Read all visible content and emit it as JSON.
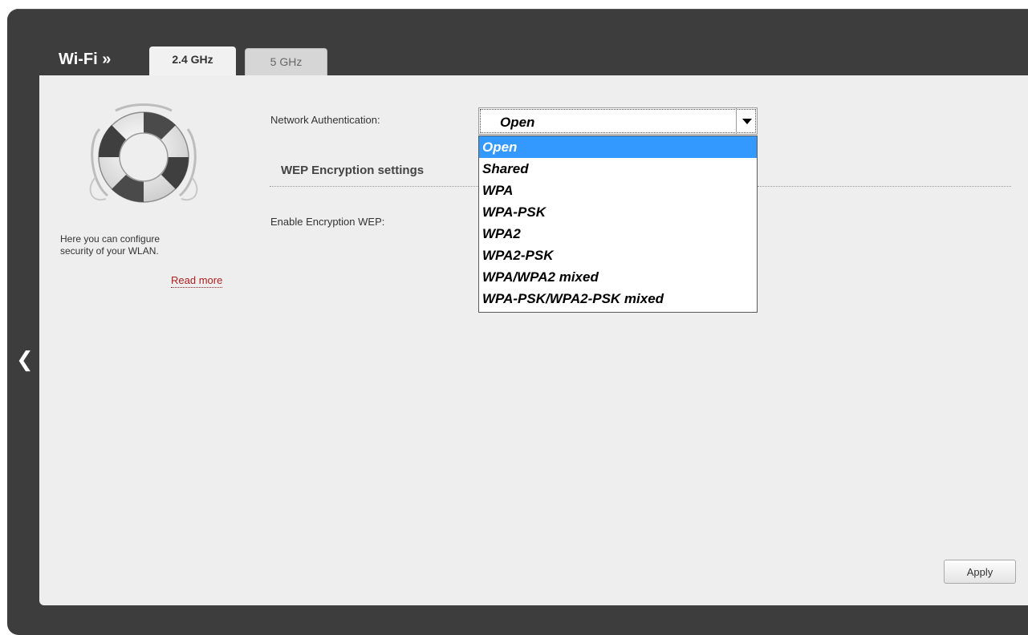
{
  "header": {
    "title": "Wi-Fi »"
  },
  "tabs": [
    {
      "label": "2.4 GHz",
      "active": true
    },
    {
      "label": "5 GHz",
      "active": false
    }
  ],
  "sidebar": {
    "icon": "lifebuoy-icon",
    "help_text": "Here you can configure\nsecurity of your WLAN.",
    "read_more": "Read more"
  },
  "form": {
    "network_auth_label": "Network Authentication:",
    "network_auth_value": "Open",
    "network_auth_options": [
      "Open",
      "Shared",
      "WPA",
      "WPA-PSK",
      "WPA2",
      "WPA2-PSK",
      "WPA/WPA2 mixed",
      "WPA-PSK/WPA2-PSK mixed"
    ],
    "network_auth_selected_index": 0,
    "wep_section_title": "WEP Encryption settings",
    "enable_wep_label": "Enable Encryption WEP:"
  },
  "actions": {
    "apply_label": "Apply"
  },
  "colors": {
    "frame": "#3d3d3d",
    "content_bg": "#eeeeee",
    "selection": "#3399ff",
    "link": "#b01e1e"
  }
}
